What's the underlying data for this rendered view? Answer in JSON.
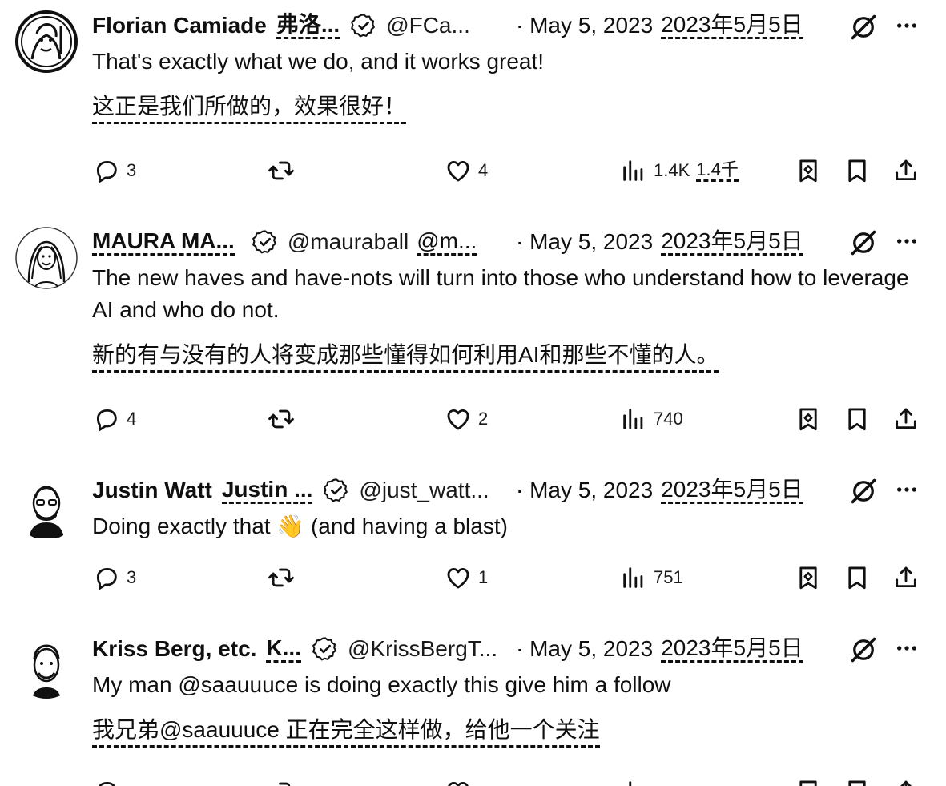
{
  "tweets": [
    {
      "name": "Florian Camiade",
      "name_translation": "弗洛...",
      "handle": "@FCa...",
      "handle_translation": "",
      "date": "· May 5, 2023",
      "date_translation": "2023年5月5日",
      "text": "That's exactly what we do, and it works great!",
      "translation": "这正是我们所做的，效果很好！",
      "replies": "3",
      "likes": "4",
      "views": "1.4K",
      "views_translation": "1.4千"
    },
    {
      "name": "MAURA MA...",
      "name_translation": "",
      "handle": "@mauraball",
      "handle_translation": "@m...",
      "date": "· May 5, 2023",
      "date_translation": "2023年5月5日",
      "text": "The new haves and have-nots will turn into those who understand how to leverage AI and who do not.",
      "translation": "新的有与没有的人将变成那些懂得如何利用AI和那些不懂的人。",
      "replies": "4",
      "likes": "2",
      "views": "740",
      "views_translation": ""
    },
    {
      "name": "Justin Watt",
      "name_translation": "Justin ...",
      "handle": "@just_watt...",
      "handle_translation": "",
      "date": "· May 5, 2023",
      "date_translation": "2023年5月5日",
      "text": "Doing exactly that 👋 (and having a blast)",
      "translation": "",
      "replies": "3",
      "likes": "1",
      "views": "751",
      "views_translation": ""
    },
    {
      "name": "Kriss Berg, etc.",
      "name_translation": "K...",
      "handle": "@KrissBergT...",
      "handle_translation": "",
      "date": "· May 5, 2023",
      "date_translation": "2023年5月5日",
      "text": "My man @saauuuce is doing exactly this give him a follow",
      "translation": "我兄弟@saauuuce 正在完全这样做，给他一个关注",
      "replies": "",
      "likes": "",
      "views": "",
      "views_translation": ""
    }
  ],
  "icons": {
    "reply": "reply-icon",
    "retweet": "retweet-icon",
    "like": "heart-icon",
    "views": "views-icon",
    "grok": "grok-icon",
    "more": "more-icon",
    "save": "bookmark-plus-icon",
    "bookmark": "bookmark-icon",
    "share": "share-icon",
    "verified": "verified-icon"
  }
}
